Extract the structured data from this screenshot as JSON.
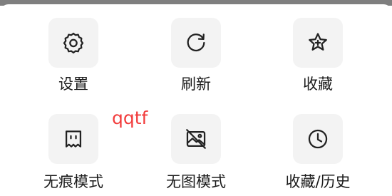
{
  "menu": {
    "items": [
      {
        "label": "设置",
        "icon": "gear-icon"
      },
      {
        "label": "刷新",
        "icon": "refresh-icon"
      },
      {
        "label": "收藏",
        "icon": "star-add-icon"
      },
      {
        "label": "无痕模式",
        "icon": "incognito-ghost-icon"
      },
      {
        "label": "无图模式",
        "icon": "no-image-icon"
      },
      {
        "label": "收藏/历史",
        "icon": "clock-icon"
      }
    ]
  },
  "overlay_text": "qqtf",
  "colors": {
    "tile_background": "#f3f3f3",
    "icon_stroke": "#222222",
    "overlay_text": "#f23c3c",
    "top_strip": "#7f7f7f"
  }
}
